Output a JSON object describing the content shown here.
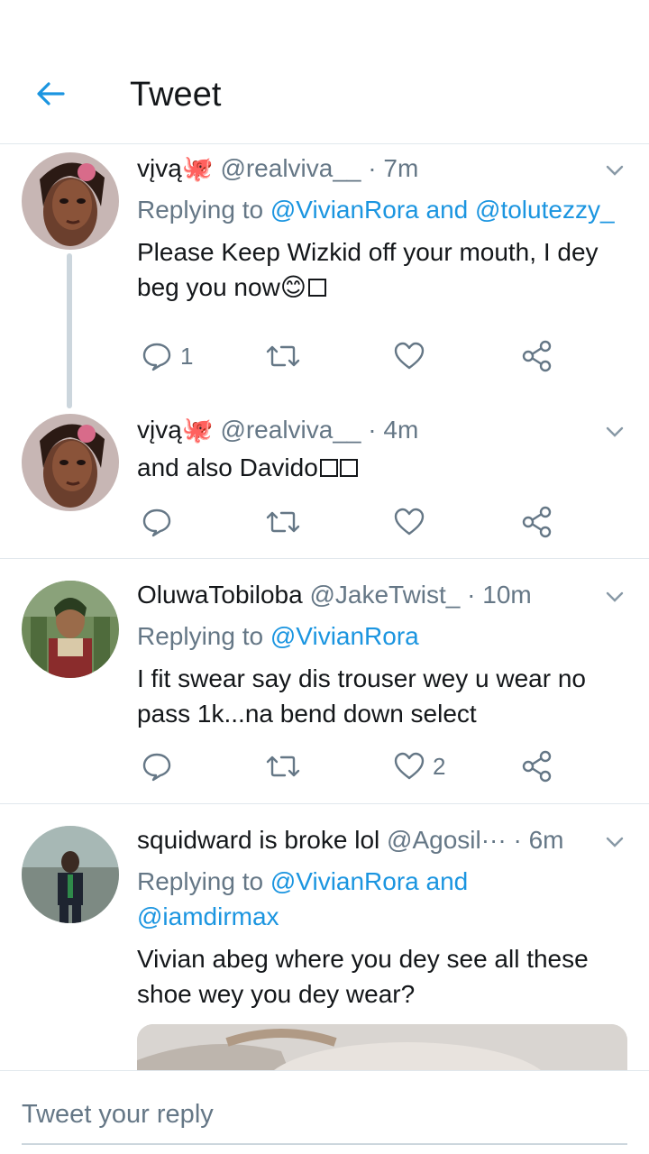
{
  "header": {
    "title": "Tweet"
  },
  "tweets": [
    {
      "name": "vįvą🐙",
      "handle": "@realviva__",
      "time": "· 7m",
      "replying_prefix": "Replying to ",
      "replying_line1": "@VivianRora and @tolutezzy_",
      "text_line1": "Please Keep Wizkid off your mouth, I dey",
      "text_line2": "beg you now😊",
      "reply_count": "1",
      "like_count": ""
    },
    {
      "name": "vįvą🐙",
      "handle": "@realviva__",
      "time": "· 4m",
      "text_line1": "and also Davido",
      "reply_count": "",
      "like_count": ""
    },
    {
      "name": "OluwaTobiloba",
      "handle": "@JakeTwist_",
      "time": "· 10m",
      "replying_prefix": "Replying to ",
      "replying_line1": "@VivianRora",
      "text_line1": "I fit swear say dis trouser wey u wear no",
      "text_line2": "pass 1k...na bend down select",
      "reply_count": "",
      "like_count": "2"
    },
    {
      "name": "squidward is broke lol",
      "handle": "@Agosil···",
      "time": "· 6m",
      "replying_prefix": "Replying to ",
      "replying_line1": "@VivianRora and",
      "replying_line2": "@iamdirmax",
      "text_line1": "Vivian abeg where you dey see all these",
      "text_line2": "shoe wey you dey wear?"
    }
  ],
  "compose": {
    "placeholder": "Tweet your reply"
  },
  "colors": {
    "accent": "#1b95e0",
    "muted": "#657786",
    "text": "#14171a",
    "divider": "#e1e8ed"
  },
  "icons": [
    "back-arrow-icon",
    "reply-icon",
    "retweet-icon",
    "like-icon",
    "share-icon",
    "chevron-down-icon"
  ]
}
